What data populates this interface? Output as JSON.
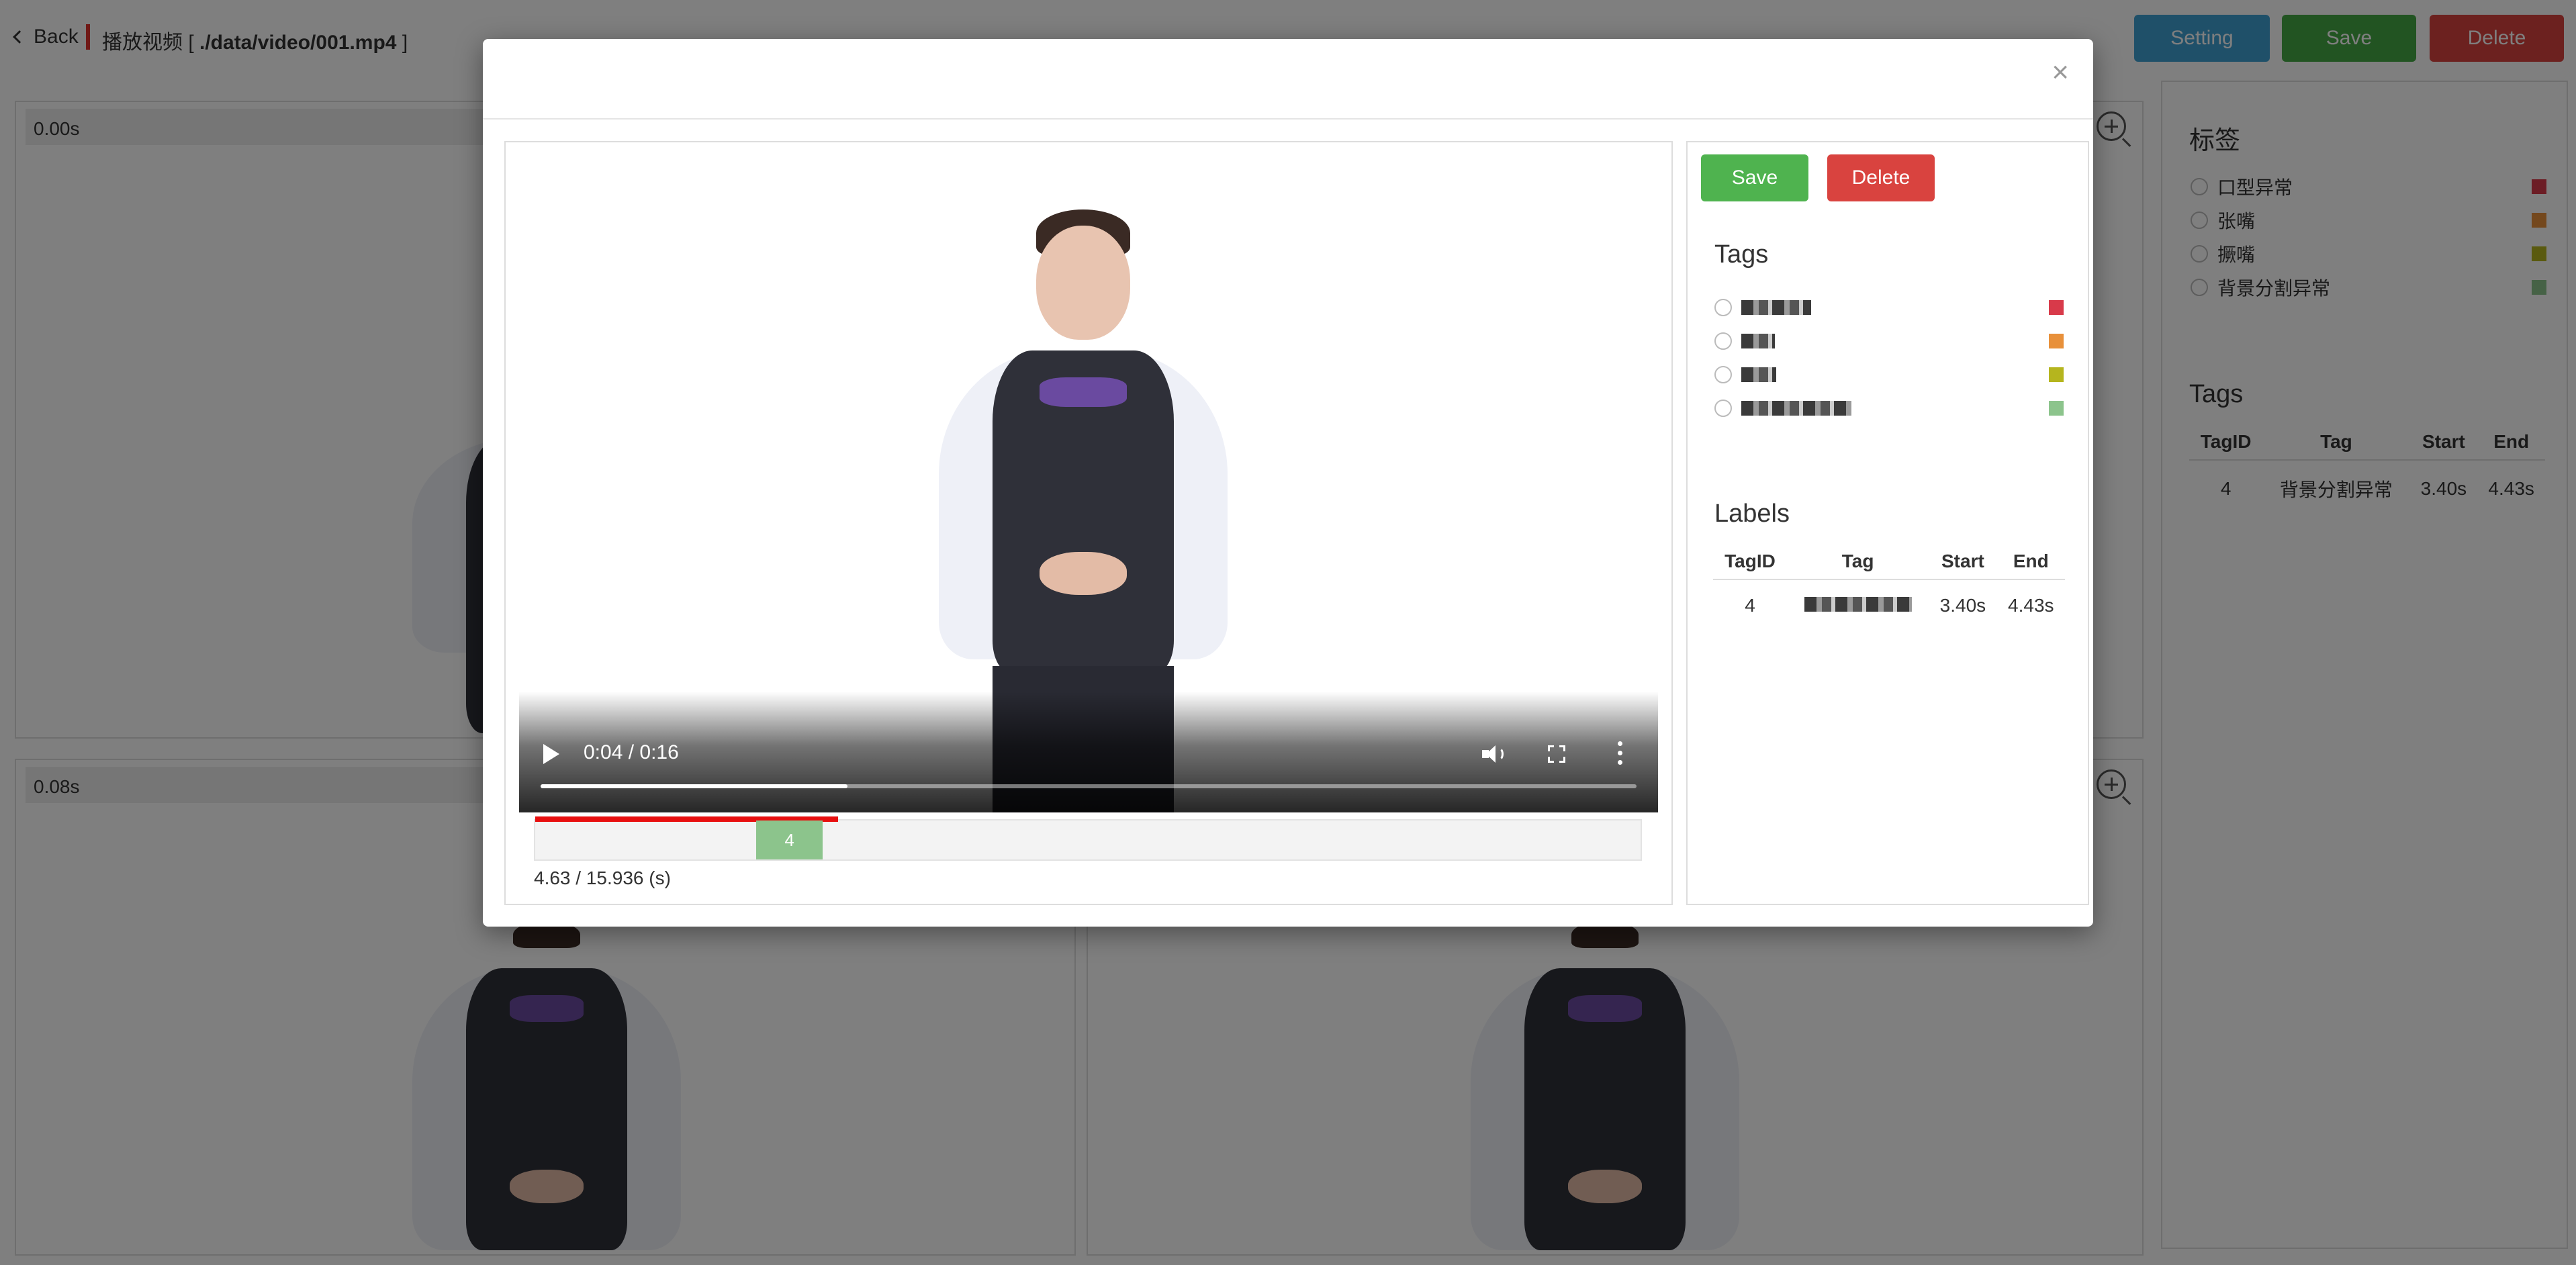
{
  "header": {
    "back_label": "Back",
    "title_prefix": "播放视频 [",
    "title_path": "./data/video/001.mp4",
    "title_suffix": "]",
    "setting_label": "Setting",
    "save_label": "Save",
    "delete_label": "Delete"
  },
  "frames": [
    {
      "time": "0.00s"
    },
    {
      "time": "0.08s"
    }
  ],
  "sidebar": {
    "tags_heading": "标签",
    "tags": [
      {
        "label": "口型异常",
        "color": "#d83a4a"
      },
      {
        "label": "张嘴",
        "color": "#e8903a"
      },
      {
        "label": "撅嘴",
        "color": "#b5b51e"
      },
      {
        "label": "背景分割异常",
        "color": "#8cc48c"
      }
    ],
    "labels_heading": "Tags",
    "columns": [
      "TagID",
      "Tag",
      "Start",
      "End"
    ],
    "rows": [
      {
        "tag_id": "4",
        "tag": "背景分割异常",
        "start": "3.40s",
        "end": "4.43s"
      }
    ]
  },
  "modal": {
    "close_label": "×",
    "video": {
      "time_label": "0:04 / 0:16",
      "progress": 0.28
    },
    "timeline": {
      "played_fraction": 0.274,
      "segment": {
        "label": "4",
        "start_fraction": 0.2,
        "end_fraction": 0.26
      },
      "readout": "4.63 / 15.936 (s)"
    },
    "save_label": "Save",
    "delete_label": "Delete",
    "tags_heading": "Tags",
    "tag_colors": [
      "#d83a4a",
      "#e8903a",
      "#b5b51e",
      "#8cc48c"
    ],
    "labels_heading": "Labels",
    "columns": [
      "TagID",
      "Tag",
      "Start",
      "End"
    ],
    "rows": [
      {
        "tag_id": "4",
        "start": "3.40s",
        "end": "4.43s"
      }
    ]
  }
}
